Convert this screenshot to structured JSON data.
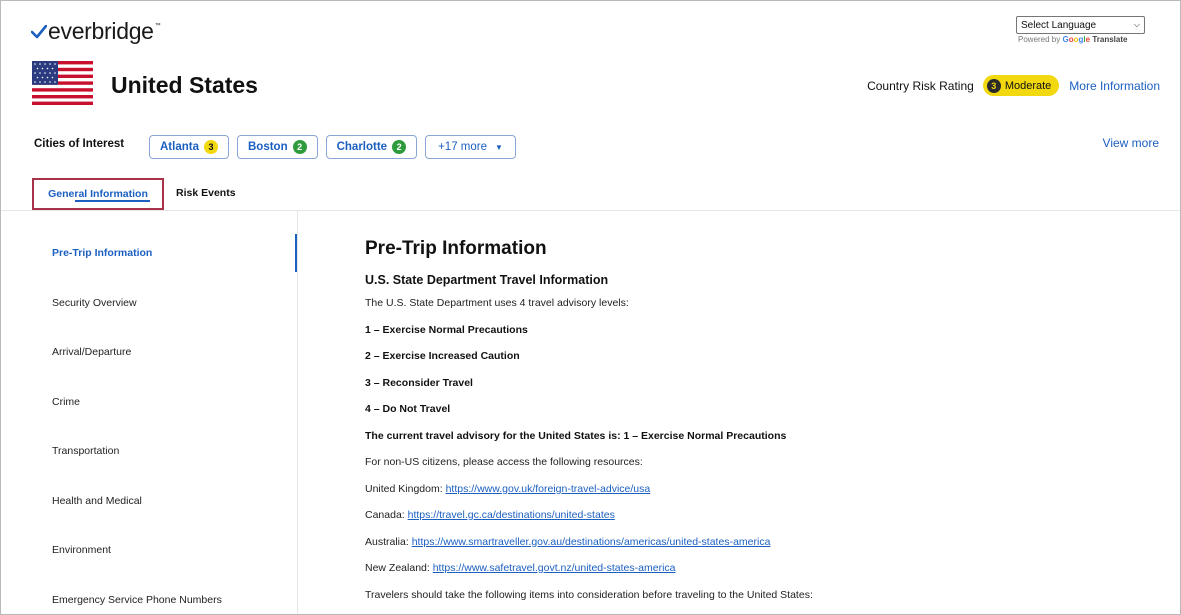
{
  "brand": {
    "name": "everbridge"
  },
  "language": {
    "select_value": "Select Language",
    "powered_prefix": "Powered by",
    "google_letters": [
      "G",
      "o",
      "o",
      "g",
      "l",
      "e"
    ],
    "translate_label": "Translate"
  },
  "country": {
    "name": "United States",
    "flag_icon": "us-flag-icon",
    "risk_label": "Country Risk Rating",
    "risk_level": "3",
    "risk_text": "Moderate",
    "risk_color": "#f2d80e",
    "more_info": "More Information"
  },
  "cities": {
    "label": "Cities of Interest",
    "items": [
      {
        "name": "Atlanta",
        "level": "3"
      },
      {
        "name": "Boston",
        "level": "2"
      },
      {
        "name": "Charlotte",
        "level": "2"
      }
    ],
    "more": "+17 more",
    "view_more": "View more"
  },
  "tabs": [
    {
      "label": "General Information",
      "active": true
    },
    {
      "label": "Risk Events",
      "active": false
    }
  ],
  "sidebar": {
    "items": [
      {
        "label": "Pre-Trip Information",
        "active": true
      },
      {
        "label": "Security Overview"
      },
      {
        "label": "Arrival/Departure"
      },
      {
        "label": "Crime"
      },
      {
        "label": "Transportation"
      },
      {
        "label": "Health and Medical"
      },
      {
        "label": "Environment"
      },
      {
        "label": "Emergency Service Phone Numbers"
      }
    ]
  },
  "content": {
    "title": "Pre-Trip Information",
    "subtitle": "U.S. State Department Travel Information",
    "intro": "The U.S. State Department uses 4 travel advisory levels:",
    "levels": [
      "1 – Exercise Normal Precautions",
      "2 – Exercise Increased Caution",
      "3 – Reconsider Travel",
      "4 – Do Not Travel"
    ],
    "current_advisory": "The current travel advisory for the United States is: 1 – Exercise Normal Precautions",
    "non_us": "For non-US citizens, please access the following resources:",
    "resources": [
      {
        "country": "United Kingdom:",
        "url": "https://www.gov.uk/foreign-travel-advice/usa"
      },
      {
        "country": "Canada:",
        "url": "https://travel.gc.ca/destinations/united-states"
      },
      {
        "country": "Australia:",
        "url": "https://www.smartraveller.gov.au/destinations/americas/united-states-america"
      },
      {
        "country": "New Zealand:",
        "url": "https://www.safetravel.govt.nz/united-states-america"
      }
    ],
    "cut_line": "Travelers should take the following items into consideration before traveling to the United States:"
  },
  "colors": {
    "accent": "#1b5fc1",
    "tab_highlight": "#a8324a",
    "level_2": "#2e9b3c",
    "level_3": "#f2d80e"
  }
}
